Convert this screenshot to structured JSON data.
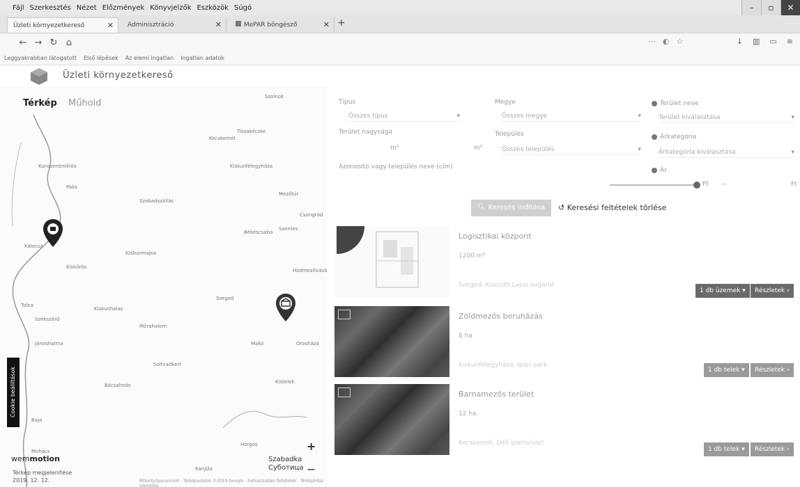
{
  "browser": {
    "menu": [
      "Fájl",
      "Szerkesztés",
      "Nézet",
      "Előzmények",
      "Könyvjelzők",
      "Eszközök",
      "Súgó"
    ],
    "tabs": [
      {
        "label": "Üzleti környezetkereső",
        "active": true
      },
      {
        "label": "Adminisztráció",
        "active": false
      },
      {
        "label": "MePAR böngésző",
        "active": false
      }
    ],
    "url": "",
    "bookmarks": [
      "Leggyakrabban látogatott",
      "Első lépések",
      "Az elemi ingatlan",
      "Ingatlan adatok"
    ]
  },
  "app": {
    "title": "Üzleti környezetkereső"
  },
  "map": {
    "tabs": [
      "Térkép",
      "Műhold"
    ],
    "place_label_line1": "Szabadka",
    "place_label_line2": "Суботица",
    "logo_light": "wem",
    "logo_bold": "motion",
    "scale_line1": "Térkép megjelenítése",
    "scale_line2": "2019. 12. 12.",
    "attribution": "Billentyűparancsok · Térképadatok ©2019 Google · Felhasználási feltételek · Térképhiba jelentése",
    "side_tab": "Cookie beállítások",
    "labels": [
      "Szeged",
      "Kecskemét",
      "Hódmezővásárhely",
      "Szentes",
      "Csongrád",
      "Kiskunfélegyháza",
      "Makó",
      "Baja",
      "Kiskunhalas",
      "Jánoshalma",
      "Mórahalom",
      "Kalocsa",
      "Szabadszállás",
      "Kunszentmiklós",
      "Tiszakécske",
      "Kiskőrös",
      "Kistelek",
      "Szolnok",
      "Mezőtúr",
      "Orosháza",
      "Békéscsaba",
      "Kiskunmajsa",
      "Soltvadkert",
      "Paks",
      "Tolna",
      "Szekszárd",
      "Bácsalmás",
      "Mohács",
      "Horgos",
      "Kanjiža"
    ]
  },
  "filters": {
    "label_type": "Típus",
    "sel_type": "Összes típus",
    "label_county": "Megye",
    "sel_county": "Összes megye",
    "label_area_name": "Terület neve",
    "sel_area_name": "Terület kiválasztása",
    "label_area": "Terület nagysága",
    "label_area_min": "m²",
    "label_area_max": "m²",
    "label_district": "Település",
    "sel_district": "Összes település",
    "label_category": "Árkategória",
    "sel_category": "Árkategória kiválasztása",
    "label_address": "Azonosító vagy település neve (cím)",
    "label_price": "Ár",
    "price_min": "Ft",
    "price_sep": "—",
    "price_max": "Ft"
  },
  "actions": {
    "search_button": "Keresés indítása",
    "reset": "Keresési feltételek törlése"
  },
  "results": [
    {
      "title": "Logisztikai központ",
      "sub": "1200 m²",
      "addr": "Szeged, Kossuth Lajos sugárút",
      "btn_more": "1 db üzemek",
      "btn_details": "Részletek"
    },
    {
      "title": "Zöldmezős beruházás",
      "sub": "8 ha",
      "addr": "Kiskunfélegyháza, Ipari park",
      "btn_more": "1 db telek",
      "btn_details": "Részletek"
    },
    {
      "title": "Barnamezős terület",
      "sub": "12 ha",
      "addr": "Kecskemét, Déli iparterület",
      "btn_more": "1 db telek",
      "btn_details": "Részletek"
    }
  ]
}
